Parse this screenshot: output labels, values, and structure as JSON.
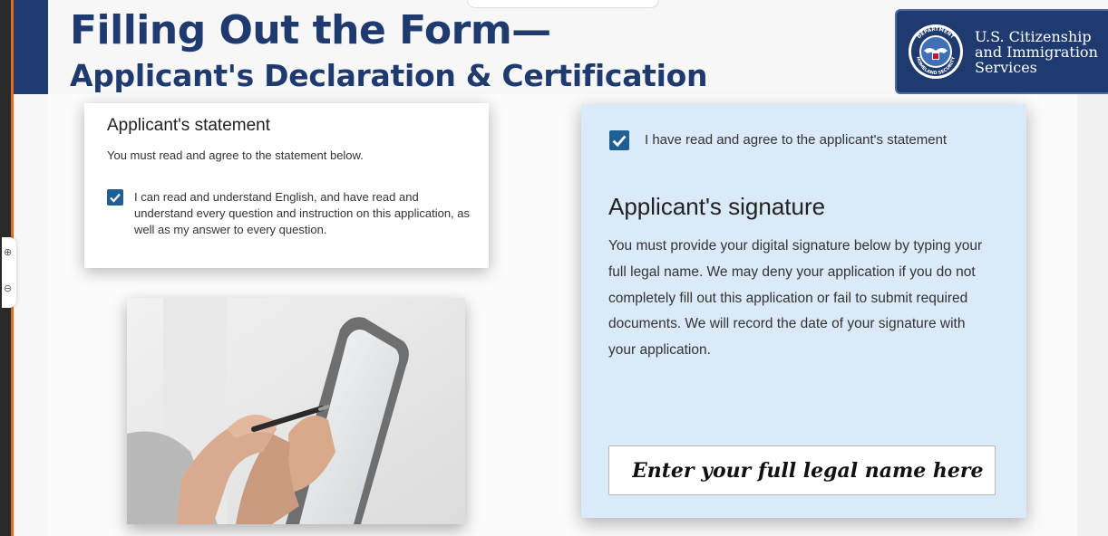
{
  "slide": {
    "title": "Filling Out the Form—",
    "subtitle": "Applicant's Declaration & Certification"
  },
  "logo": {
    "line1": "U.S. Citizenship",
    "line2": "and Immigration",
    "line3": "Services",
    "seal_top_text": "DEPARTMENT",
    "seal_bottom_text": "HOMELAND SECURITY",
    "brand_color": "#1f3a6e"
  },
  "statement_card": {
    "heading": "Applicant's statement",
    "instruction": "You must read and agree to the statement below.",
    "checkbox_checked": true,
    "checkbox_label": "I can read and understand English, and have read and understand every question and instruction on this application, as well as my answer to every question."
  },
  "signature_card": {
    "agree_checked": true,
    "agree_label": "I have read and agree to the applicant's statement",
    "heading": "Applicant's signature",
    "body": "You must provide your digital signature below by typing your full legal name. We may deny your application if you do not completely fill out this application or fail to submit required documents. We will record the date of your signature with your application.",
    "name_placeholder": "Enter your full legal name here",
    "background_color": "#dbeaf8"
  },
  "zoom_controls": {
    "zoom_in_icon": "zoom-in-icon",
    "zoom_out_icon": "zoom-out-icon"
  },
  "colors": {
    "accent_orange": "#e06c1f",
    "checkbox_blue": "#1f5f94"
  }
}
